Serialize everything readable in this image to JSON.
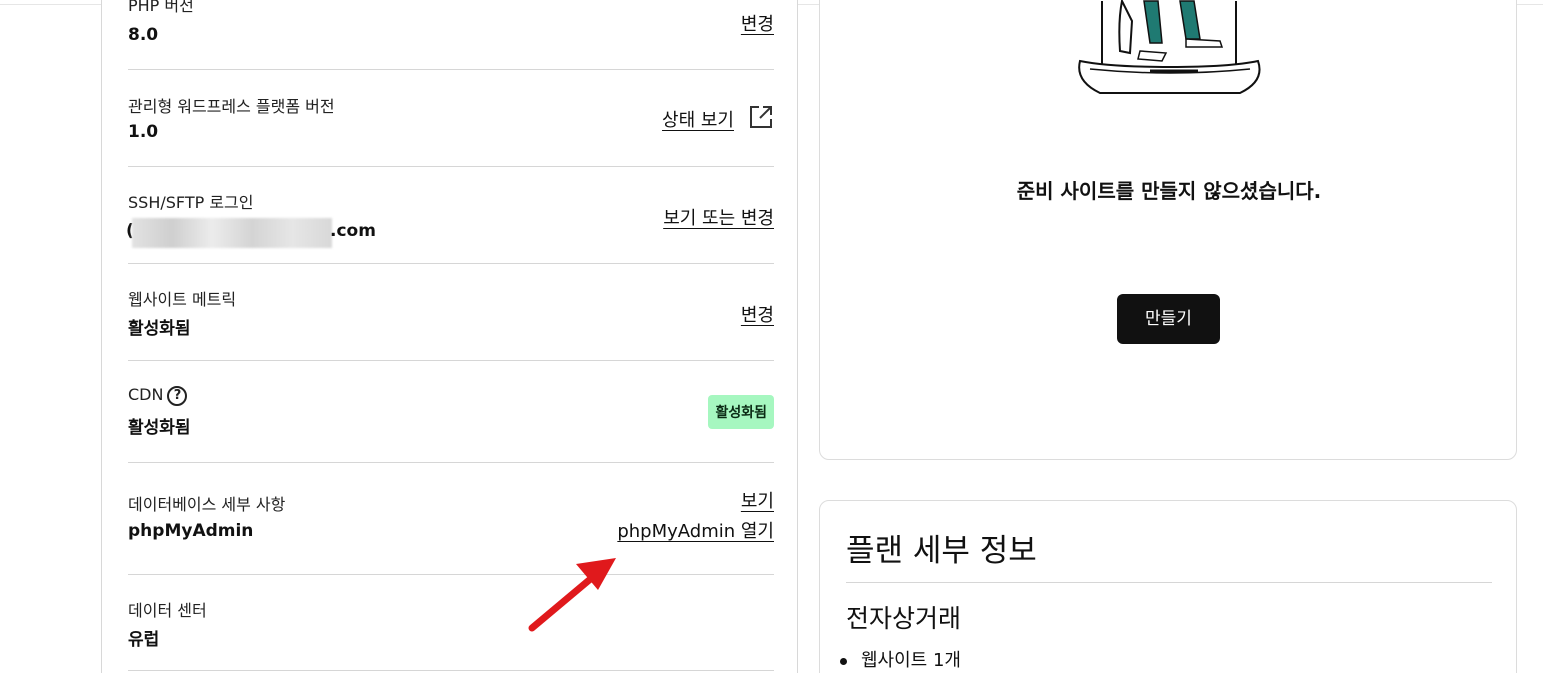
{
  "settings": {
    "php": {
      "label": "PHP 버전",
      "value": "8.0",
      "action": "변경"
    },
    "platform": {
      "label": "관리형 워드프레스 플랫폼 버전",
      "value": "1.0",
      "action": "상태 보기"
    },
    "ssh": {
      "label": "SSH/SFTP 로그인",
      "value_suffix": ".com",
      "action": "보기 또는 변경"
    },
    "metrics": {
      "label": "웹사이트 메트릭",
      "value": "활성화됨",
      "action": "변경"
    },
    "cdn": {
      "label": "CDN",
      "help": "?",
      "value": "활성화됨",
      "badge": "활성화됨"
    },
    "database": {
      "label": "데이터베이스 세부 사항",
      "value": "phpMyAdmin",
      "action_view": "보기",
      "action_open": "phpMyAdmin 열기"
    },
    "datacenter": {
      "label": "데이터 센터",
      "value": "유럽"
    }
  },
  "staging": {
    "message": "준비 사이트를 만들지 않으셨습니다.",
    "create_label": "만들기"
  },
  "plan": {
    "title": "플랜 세부 정보",
    "name": "전자상거래",
    "features": [
      "웹사이트 1개"
    ]
  },
  "colors": {
    "badge_bg": "#a6f7c0",
    "button_bg": "#111111",
    "arrow": "#e0191c",
    "illustration_teal": "#1f7a72"
  }
}
